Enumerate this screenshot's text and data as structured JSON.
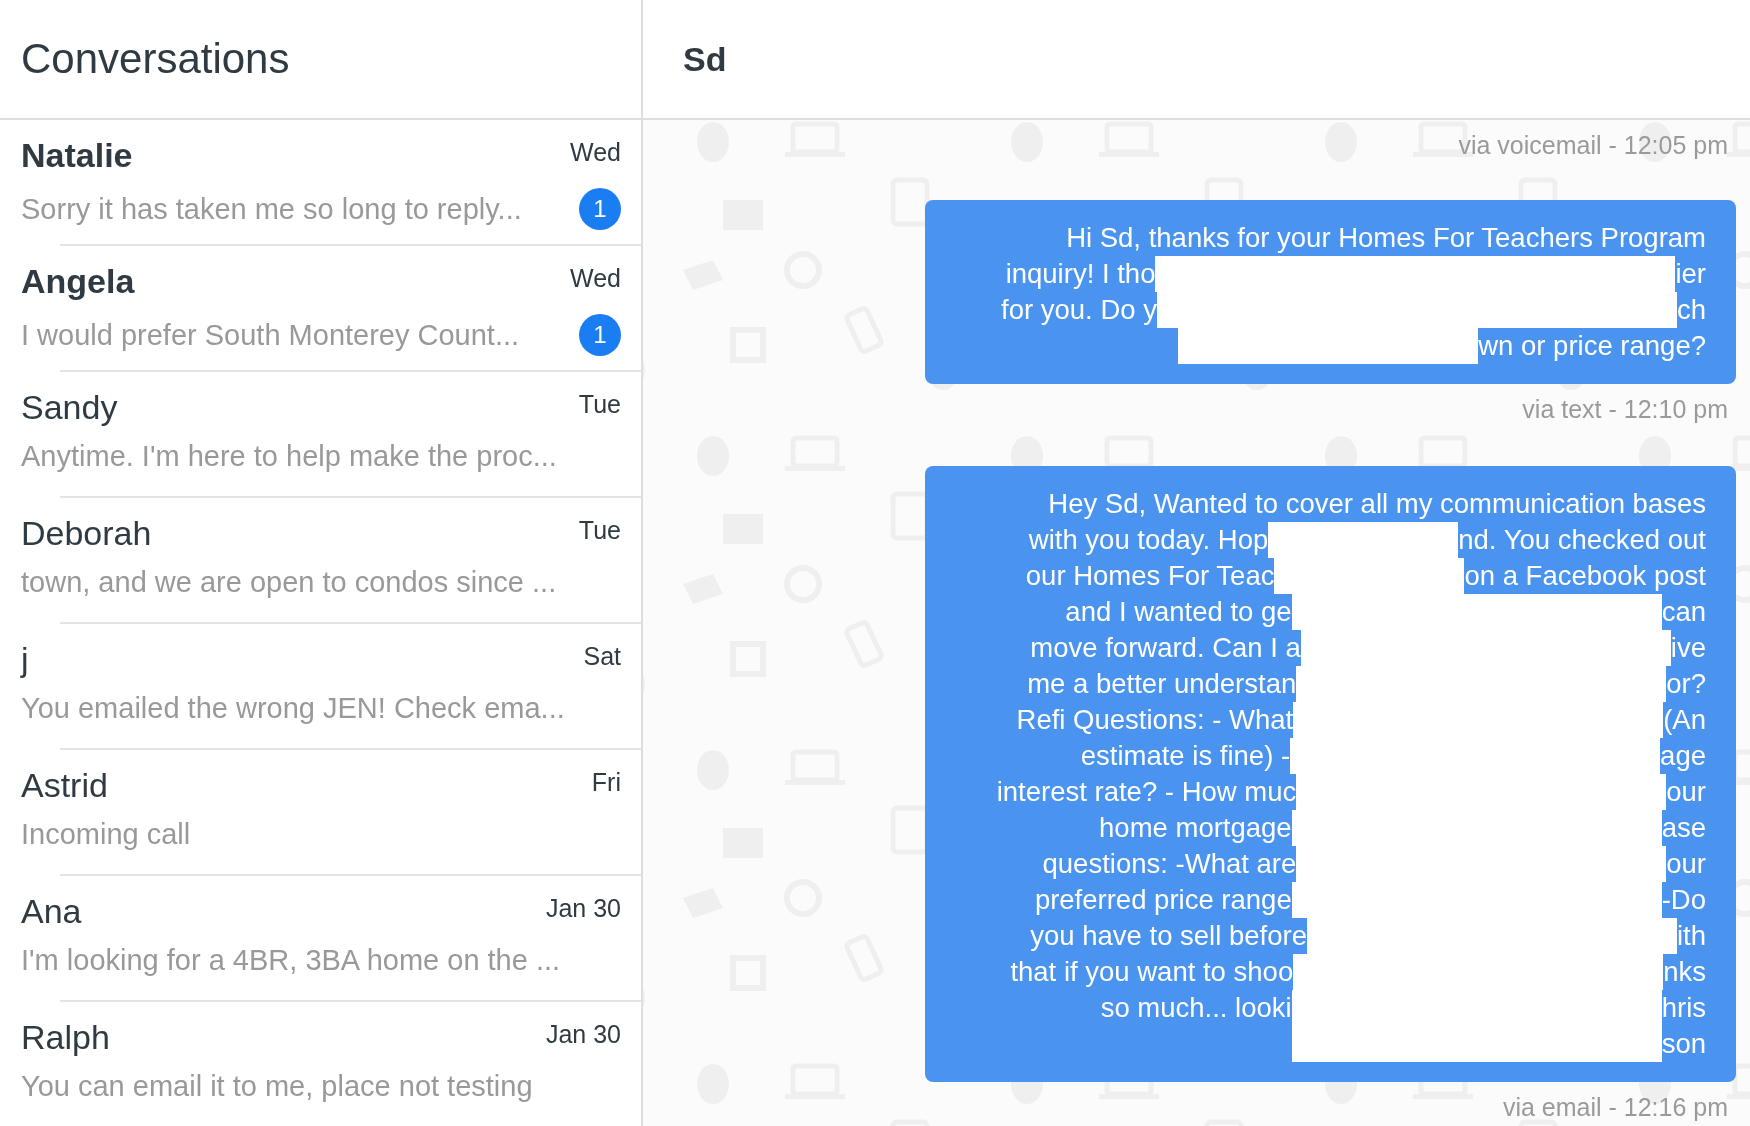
{
  "sidebar": {
    "title": "Conversations",
    "conversations": [
      {
        "name": "Natalie",
        "date": "Wed",
        "preview": "Sorry it has taken me so long to reply...",
        "unread": true,
        "badge": "1"
      },
      {
        "name": "Angela",
        "date": "Wed",
        "preview": "I would prefer South Monterey Count...",
        "unread": true,
        "badge": "1"
      },
      {
        "name": "Sandy",
        "date": "Tue",
        "preview": "Anytime. I'm here to help make the proc...",
        "unread": false
      },
      {
        "name": "Deborah",
        "date": "Tue",
        "preview": "town, and we are open to condos since ...",
        "unread": false
      },
      {
        "name": "j",
        "date": "Sat",
        "preview": "You emailed the wrong JEN! Check ema...",
        "unread": false
      },
      {
        "name": "Astrid",
        "date": "Fri",
        "preview": "Incoming call",
        "unread": false
      },
      {
        "name": "Ana",
        "date": "Jan 30",
        "preview": "I'm looking for a 4BR, 3BA home on the ...",
        "unread": false
      },
      {
        "name": "Ralph",
        "date": "Jan 30",
        "preview": "You can email it to me, place not testing",
        "unread": false
      }
    ]
  },
  "chat": {
    "title": "Sd",
    "items": [
      {
        "kind": "meta",
        "text": "via voicemail - 12:05 pm"
      },
      {
        "kind": "bubble",
        "lines": [
          {
            "left": "Hi Sd, thanks for your Homes For Teachers Program"
          },
          {
            "left": "inquiry! I tho",
            "right": "ier"
          },
          {
            "left": "for you. Do y",
            "right": "ch"
          },
          {
            "right": "wn or price range?"
          }
        ]
      },
      {
        "kind": "meta",
        "text": "via text - 12:10 pm"
      },
      {
        "kind": "bubble",
        "lines": [
          {
            "left": "Hey Sd, Wanted to cover all my communication bases"
          },
          {
            "left": "with you today. Hop",
            "right": "nd. You checked out"
          },
          {
            "left": "our Homes For Teac",
            "right": "on a Facebook post"
          },
          {
            "left": "and I wanted to ge",
            "right": "can"
          },
          {
            "left": "move forward. Can I a",
            "right": "ive"
          },
          {
            "left": "me a better understan",
            "right": "or?"
          },
          {
            "left": "Refi Questions: - What",
            "right": "(An"
          },
          {
            "left": "estimate is fine) -",
            "right": "age"
          },
          {
            "left": "interest rate? - How muc",
            "right": "our"
          },
          {
            "left": "home mortgage",
            "right": "ase"
          },
          {
            "left": "questions: -What are",
            "right": "our"
          },
          {
            "left": "preferred price range",
            "right": "-Do"
          },
          {
            "left": "you have to sell before",
            "right": "ith"
          },
          {
            "left": "that if you want to shoo",
            "right": "nks"
          },
          {
            "left": "so much... looki",
            "right": "hris"
          },
          {
            "right": "son"
          }
        ]
      },
      {
        "kind": "meta",
        "text": "via email - 12:16 pm"
      }
    ]
  }
}
